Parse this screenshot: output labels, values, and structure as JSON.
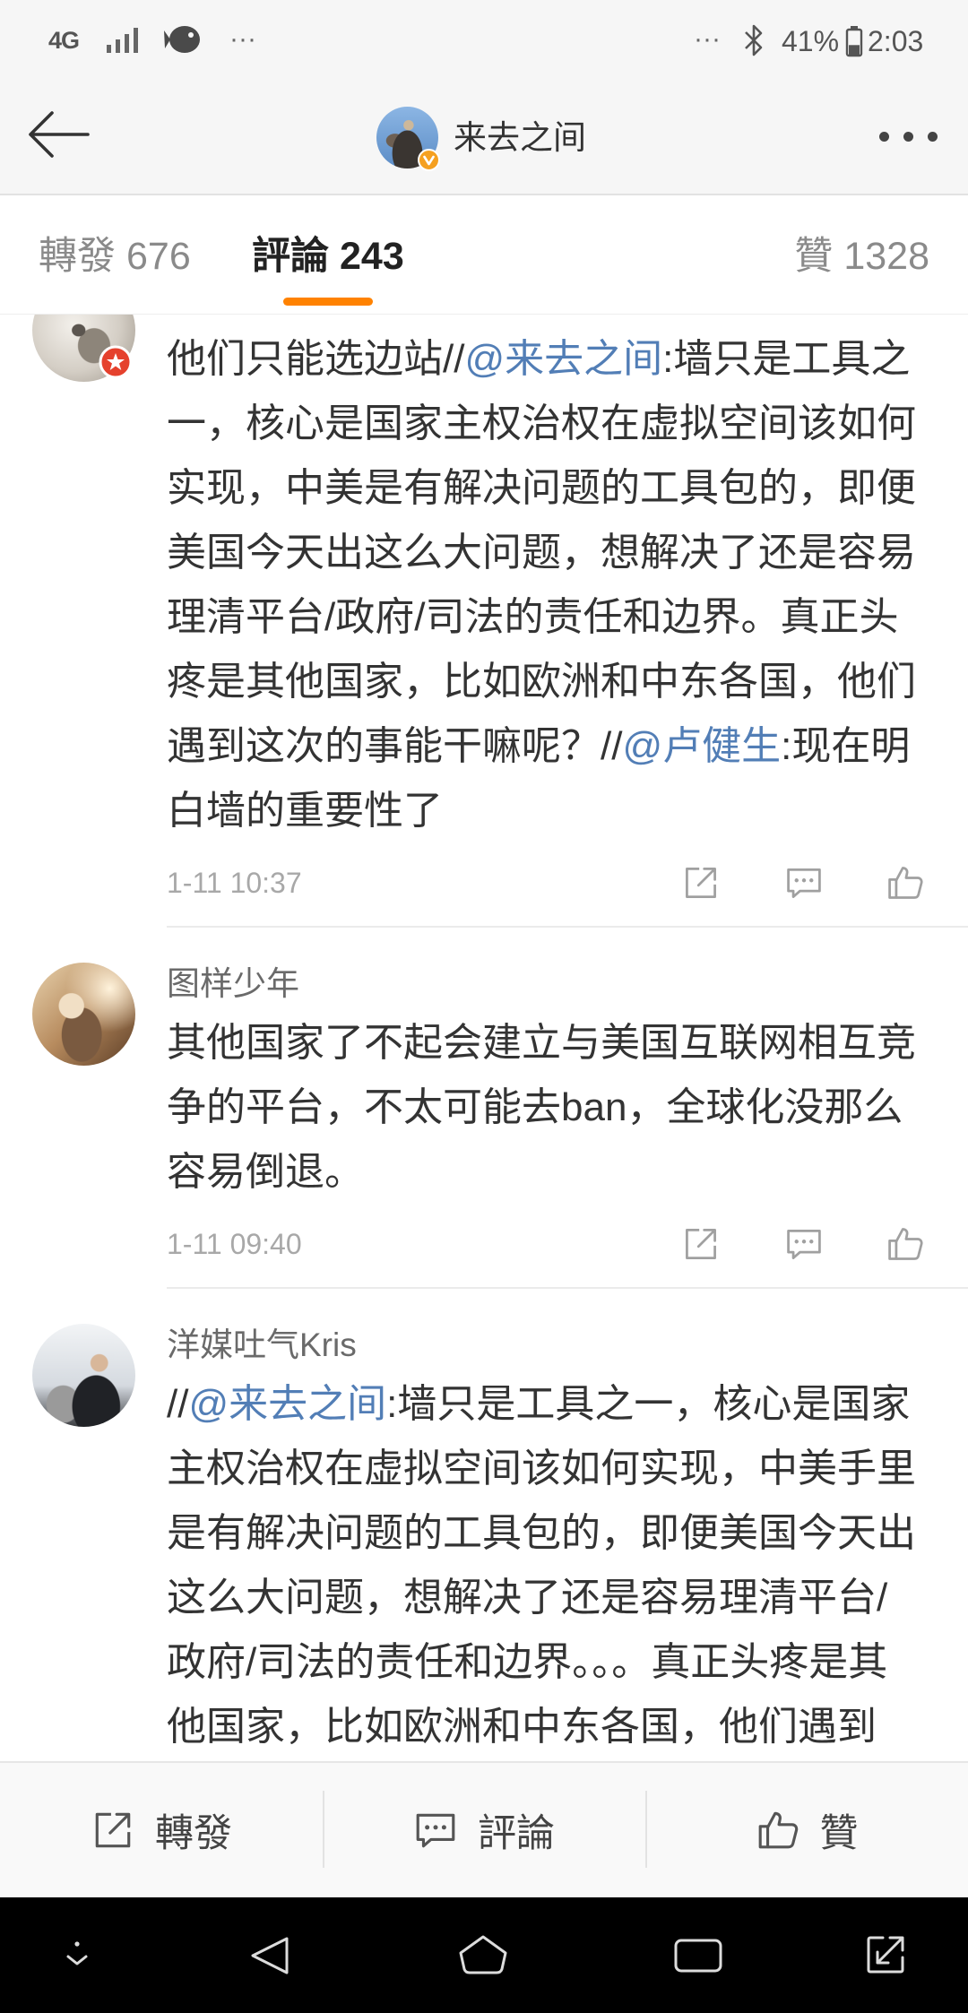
{
  "status_bar": {
    "network": "4G",
    "left_more": "···",
    "right_more": "···",
    "battery": "41%",
    "battery_level": 0.41,
    "time": "2:03"
  },
  "header": {
    "title": "来去之间",
    "back_icon": "back-arrow-icon",
    "verified_icon": "verified-badge-icon",
    "more_icon": "more-icon"
  },
  "tabs": [
    {
      "label": "轉發",
      "count": "676",
      "active": false
    },
    {
      "label": "評論",
      "count": "243",
      "active": true
    },
    {
      "label": "贊",
      "count": "1328",
      "active": false
    }
  ],
  "comments": [
    {
      "segments": [
        {
          "kind": "text",
          "text": "他们只能选边站//"
        },
        {
          "kind": "mention",
          "text": "@来去之间"
        },
        {
          "kind": "text",
          "text": ":墙只是工具之一，核心是国家主权治权在虚拟空间该如何实现，中美是有解决问题的工具包的，即便美国今天出这么大问题，想解决了还是容易理清平台/政府/司法的责任和边界。真正头疼是其他国家，比如欧洲和中东各国，他们遇到这次的事能干嘛呢？//"
        },
        {
          "kind": "mention",
          "text": "@卢健生"
        },
        {
          "kind": "text",
          "text": ":现在明白墙的重要性了"
        }
      ],
      "time": "1-11 10:37"
    },
    {
      "username": "图样少年",
      "segments": [
        {
          "kind": "text",
          "text": "其他国家了不起会建立与美国互联网相互竞争的平台，不太可能去ban，全球化没那么容易倒退。"
        }
      ],
      "time": "1-11 09:40"
    },
    {
      "username": "洋媒吐气Kris",
      "segments": [
        {
          "kind": "text",
          "text": "//"
        },
        {
          "kind": "mention",
          "text": "@来去之间"
        },
        {
          "kind": "text",
          "text": ":墙只是工具之一，核心是国家主权治权在虚拟空间该如何实现，中美手里是有解决问题的工具包的，即便美国今天出这么大问题，想解决了还是容易理清平台/政府/司法的责任和边界。。。真正头疼是其他国家，比如欧洲和中东各国，他们遇到"
        }
      ]
    }
  ],
  "comment_actions": {
    "icons": [
      "share-icon",
      "comment-icon",
      "like-icon"
    ]
  },
  "action_bar": {
    "repost": "轉發",
    "comment": "評論",
    "like": "贊"
  },
  "nav_bar": {
    "icons": [
      "hide-nav-icon",
      "back-triangle-icon",
      "home-icon",
      "recents-icon",
      "expand-icon"
    ]
  },
  "colors": {
    "accent": "#ff8200",
    "mention": "#527eb6",
    "verified": "#f5a020",
    "user_badge": "#e5412d",
    "text": "#333333",
    "muted": "#a8a8a8"
  }
}
